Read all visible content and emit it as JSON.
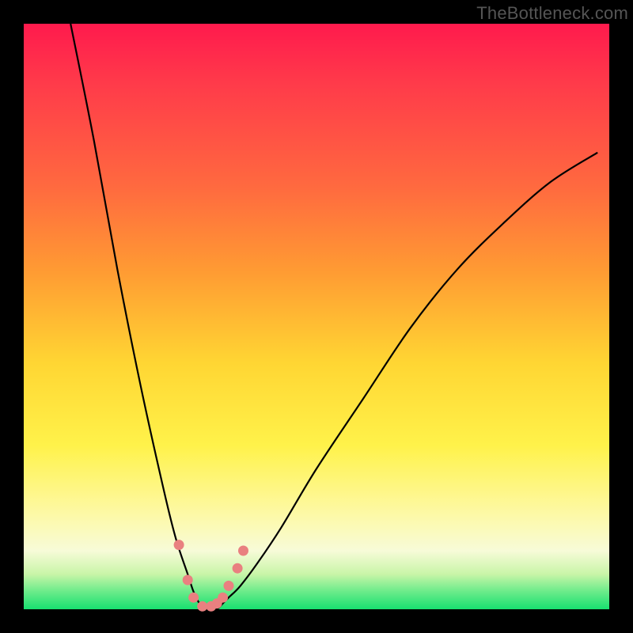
{
  "watermark": "TheBottleneck.com",
  "colors": {
    "frame": "#000000",
    "curve": "#000000",
    "markers": "#e98080",
    "gradient_top": "#ff1a4d",
    "gradient_bottom": "#18e070"
  },
  "chart_data": {
    "type": "line",
    "title": "",
    "xlabel": "",
    "ylabel": "",
    "xlim": [
      0,
      100
    ],
    "ylim": [
      0,
      100
    ],
    "x": [
      8,
      12,
      16,
      20,
      24,
      26,
      28,
      29,
      30,
      31,
      32,
      33,
      34,
      35,
      37,
      40,
      44,
      50,
      58,
      66,
      74,
      82,
      90,
      98
    ],
    "values": [
      100,
      80,
      58,
      38,
      20,
      12,
      6,
      3,
      1,
      0,
      0,
      0,
      1,
      2,
      4,
      8,
      14,
      24,
      36,
      48,
      58,
      66,
      73,
      78
    ],
    "markers": {
      "x": [
        26.5,
        28,
        29,
        30.5,
        32,
        33,
        34,
        35,
        36.5,
        37.5
      ],
      "y": [
        11,
        5,
        2,
        0.5,
        0.5,
        1,
        2,
        4,
        7,
        10
      ]
    }
  }
}
